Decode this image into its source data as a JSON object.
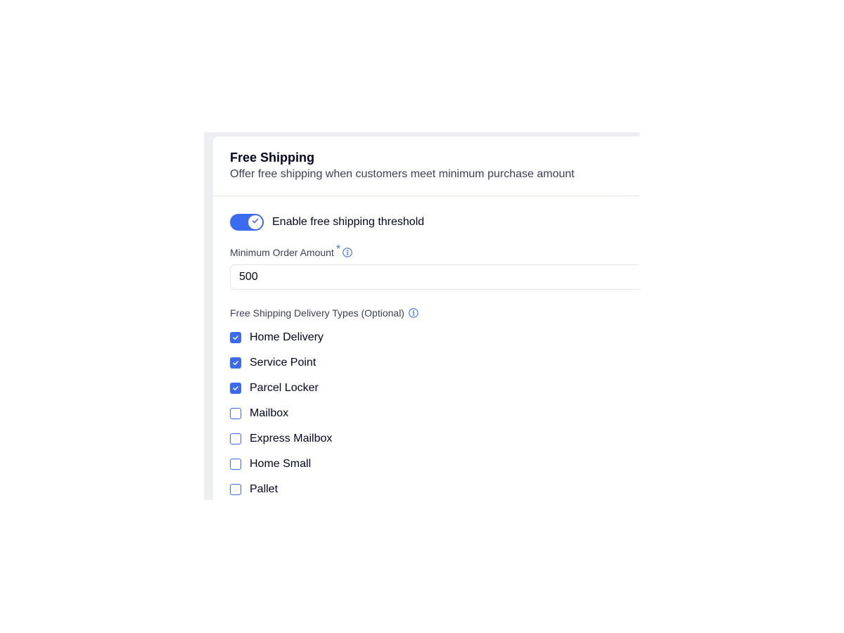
{
  "card": {
    "title": "Free Shipping",
    "subtitle": "Offer free shipping when customers meet minimum purchase amount"
  },
  "toggle": {
    "label": "Enable free shipping threshold",
    "enabled": true
  },
  "min_order": {
    "label": "Minimum Order Amount",
    "required_mark": "*",
    "value": "500"
  },
  "delivery_types": {
    "label": "Free Shipping Delivery Types (Optional)",
    "items": [
      {
        "label": "Home Delivery",
        "checked": true
      },
      {
        "label": "Service Point",
        "checked": true
      },
      {
        "label": "Parcel Locker",
        "checked": true
      },
      {
        "label": "Mailbox",
        "checked": false
      },
      {
        "label": "Express Mailbox",
        "checked": false
      },
      {
        "label": "Home Small",
        "checked": false
      },
      {
        "label": "Pallet",
        "checked": false
      }
    ]
  },
  "colors": {
    "accent": "#3b6bf0",
    "text": "#000624",
    "secondary_text": "#3b4057",
    "border": "#dfe5eb",
    "frame_bg": "#eeeff2"
  },
  "icons": {
    "toggle_check": "check-icon",
    "info": "info-icon",
    "checkbox_check": "check-icon"
  }
}
